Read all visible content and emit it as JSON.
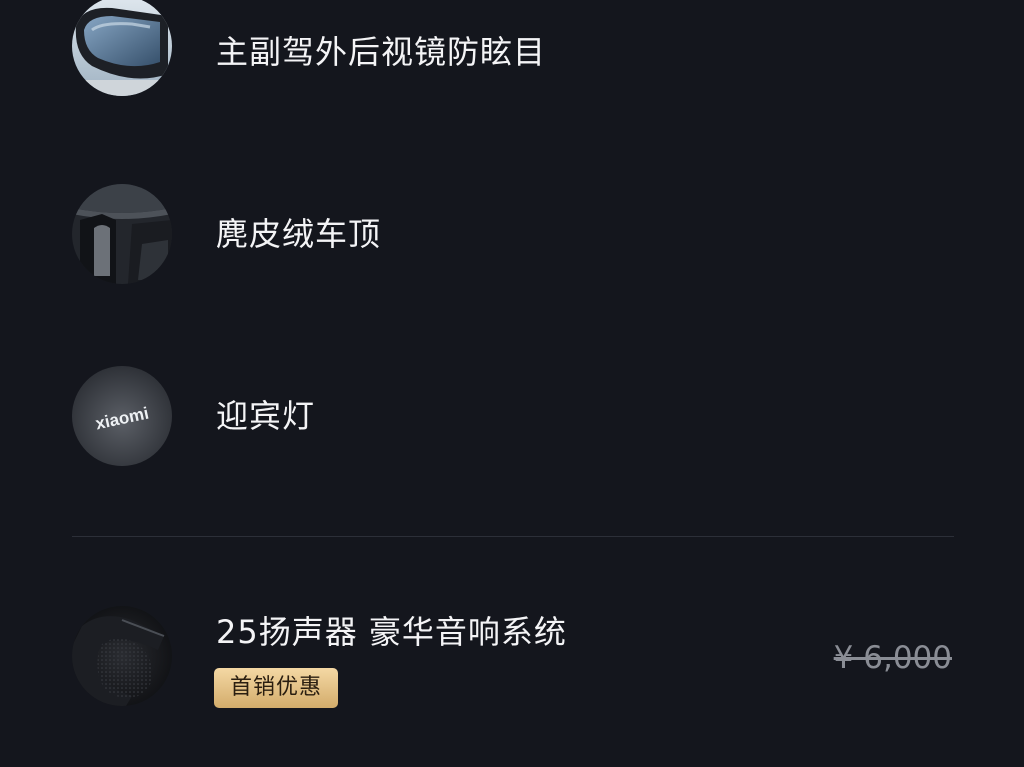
{
  "options": [
    {
      "label": "主副驾外后视镜防眩目",
      "image": "mirror-icon"
    },
    {
      "label": "麂皮绒车顶",
      "image": "headliner-icon"
    },
    {
      "label": "迎宾灯",
      "image": "welcome-light-icon",
      "projection_text": "xiaomi"
    }
  ],
  "upgrade": {
    "title": "25扬声器 豪华音响系统",
    "badge": "首销优惠",
    "original_price": "¥ 6,000",
    "image": "speaker-icon"
  },
  "colors": {
    "background": "#14161d",
    "text": "#f2f2f4",
    "badge_gold": "#dcb779",
    "price_gray": "#8a8d95"
  }
}
